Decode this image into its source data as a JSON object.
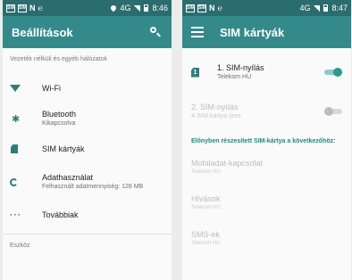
{
  "left": {
    "status": {
      "time": "8:46",
      "network": "4G"
    },
    "title": "Beállítások",
    "section_wireless": "Vezeték nélküli és egyéb hálózatok",
    "items": [
      {
        "icon": "wifi-icon",
        "title": "Wi-Fi",
        "subtitle": ""
      },
      {
        "icon": "bluetooth-icon",
        "title": "Bluetooth",
        "subtitle": "Kikapcsolva"
      },
      {
        "icon": "sim-card-icon",
        "title": "SIM kártyák",
        "subtitle": ""
      },
      {
        "icon": "data-usage-icon",
        "title": "Adathasználat",
        "subtitle": "Felhasznált adatmennyiség: 128 MB"
      },
      {
        "icon": "more-icon",
        "title": "Továbbiak",
        "subtitle": ""
      }
    ],
    "section_device": "Eszköz"
  },
  "right": {
    "status": {
      "time": "8:47",
      "network": "4G"
    },
    "title": "SIM kártyák",
    "sim1": {
      "badge": "1",
      "title": "1. SIM-nyílás",
      "subtitle": "Telekom HU",
      "enabled": true
    },
    "sim2": {
      "title": "2. SIM-nyílás",
      "subtitle": "A SIM-kártya üres",
      "enabled": false
    },
    "preferred_header": "Előnyben részesített SIM-kártya a következőhöz:",
    "preferences": [
      {
        "title": "Mobiladat-kapcsolat",
        "subtitle": "Telekom HU"
      },
      {
        "title": "Hívások",
        "subtitle": "Telekom HU"
      },
      {
        "title": "SMS-ek",
        "subtitle": "Telekom HU"
      }
    ]
  },
  "colors": {
    "statusbar": "#2b6d6e",
    "appbar": "#348a8a",
    "accent": "#2e7d7b"
  }
}
